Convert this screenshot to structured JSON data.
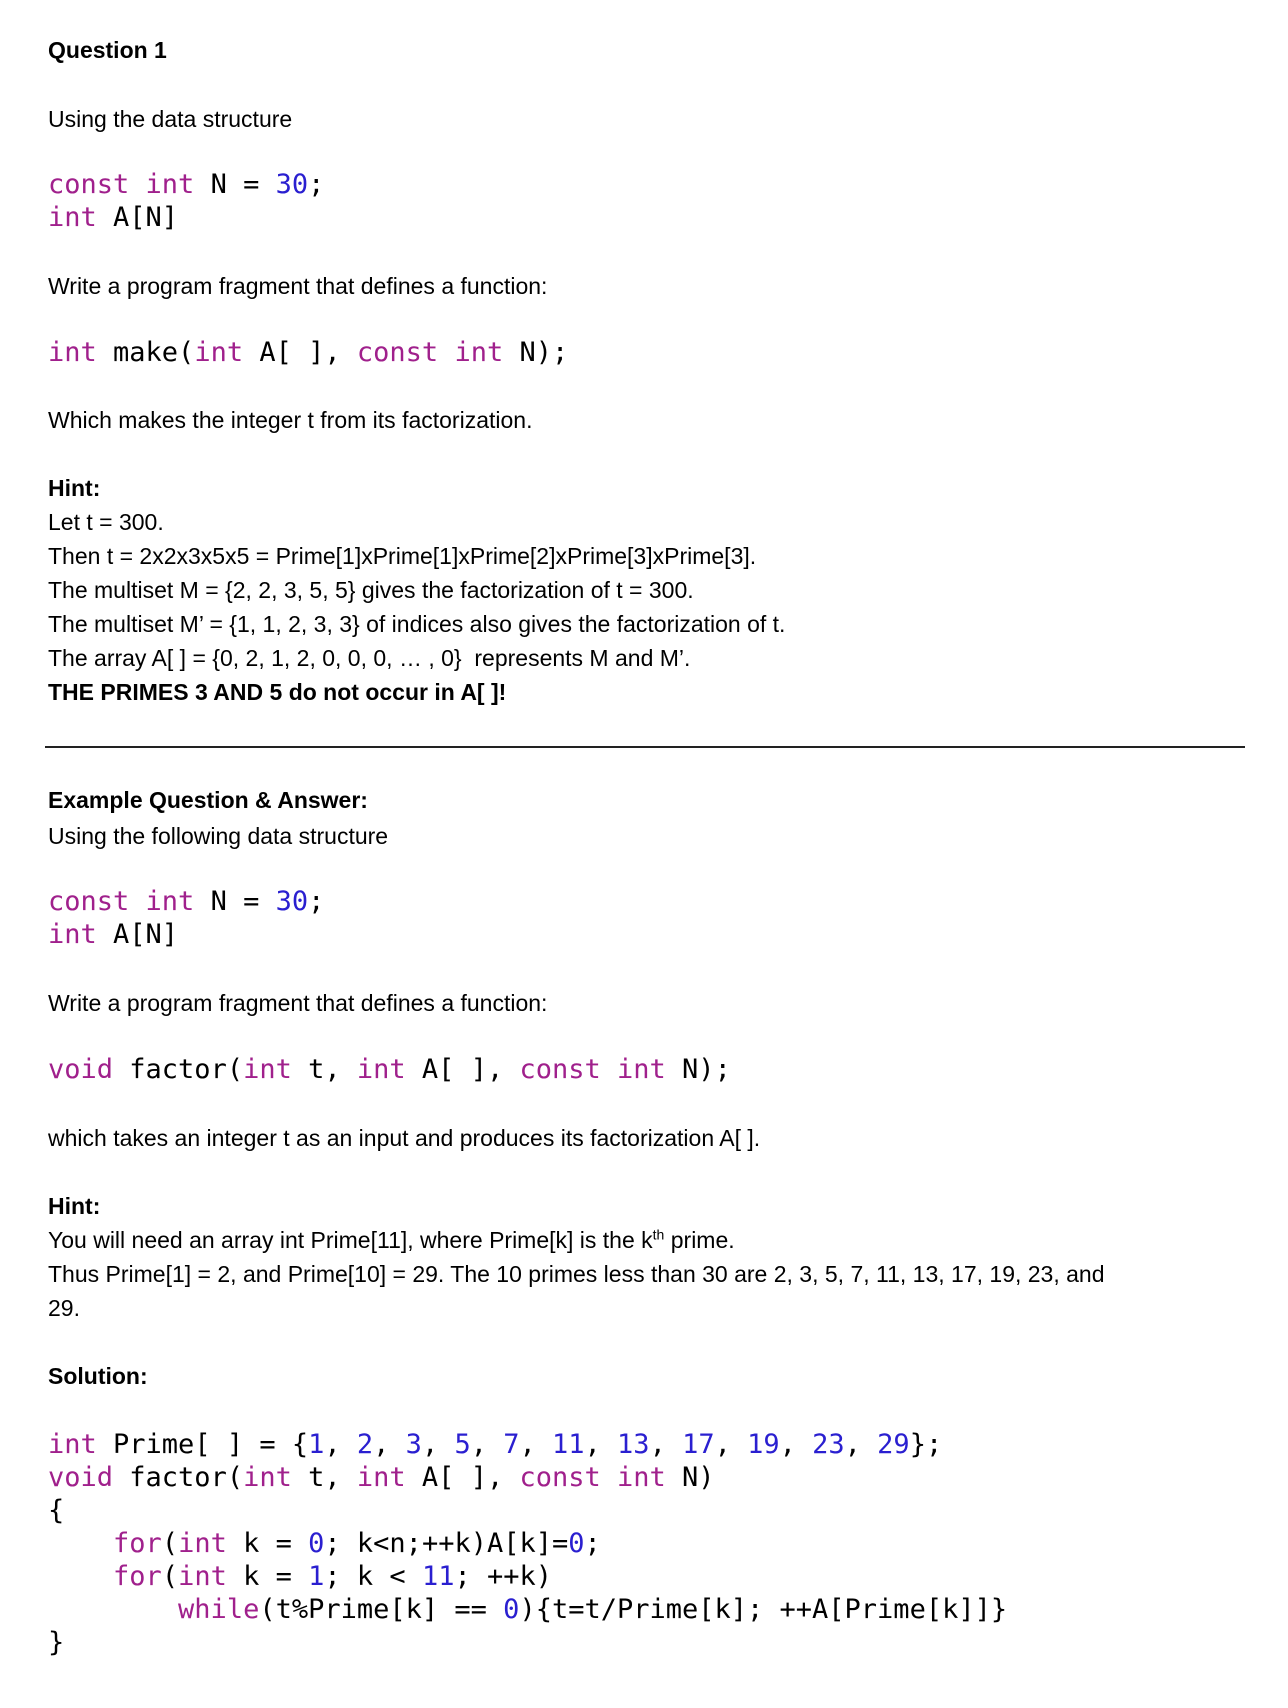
{
  "q1": {
    "title": "Question 1",
    "intro": "Using the data structure",
    "ds_line1": [
      "const",
      " ",
      "int",
      " N = ",
      "30",
      ";"
    ],
    "ds_line2": [
      "int",
      " A[N]"
    ],
    "task": "Write a program fragment that defines a function:",
    "signature": [
      "int",
      " make(",
      "int",
      " A[ ], ",
      "const",
      " ",
      "int",
      " N);"
    ],
    "desc": "Which makes the integer t from its factorization.",
    "hint_title": "Hint:",
    "hint_lines": [
      "Let t = 300.",
      "Then t = 2x2x3x5x5 = Prime[1]xPrime[1]xPrime[2]xPrime[3]xPrime[3].",
      "The multiset M = {2, 2, 3, 5, 5} gives the factorization of t = 300.",
      "The multiset M’ = {1, 1, 2, 3, 3} of indices also gives the factorization of t.",
      "The array A[ ] = {0, 2, 1, 2, 0, 0, 0, … , 0}  represents M and M’."
    ],
    "hint_warning": "THE PRIMES 3 AND 5 do not occur in A[ ]!"
  },
  "example": {
    "title": "Example Question & Answer:",
    "intro": "Using the following data structure",
    "ds_line1": [
      "const",
      " ",
      "int",
      " N = ",
      "30",
      ";"
    ],
    "ds_line2": [
      "int",
      " A[N]"
    ],
    "task": "Write a program fragment that defines a function:",
    "signature": [
      "void",
      " factor(",
      "int",
      " t, ",
      "int",
      " A[ ], ",
      "const",
      " ",
      "int",
      " N);"
    ],
    "desc": "which takes an integer t as an input and produces its factorization A[ ].",
    "hint_title": "Hint:",
    "hint_line1_a": "You will need an array int Prime[11], where Prime[k] is the k",
    "hint_line1_sup": "th",
    "hint_line1_b": " prime.",
    "hint_line2": "Thus Prime[1] = 2, and Prime[10] = 29. The 10 primes less than 30 are 2, 3, 5, 7, 11, 13, 17, 19, 23, and",
    "hint_line3": "29.",
    "solution_title": "Solution:",
    "solution_code": {
      "line1": [
        "int",
        " Prime[ ] = {",
        "1",
        ", ",
        "2",
        ", ",
        "3",
        ", ",
        "5",
        ", ",
        "7",
        ", ",
        "11",
        ", ",
        "13",
        ", ",
        "17",
        ", ",
        "19",
        ", ",
        "23",
        ", ",
        "29",
        "};"
      ],
      "line2": [
        "void",
        " factor(",
        "int",
        " t, ",
        "int",
        " A[ ], ",
        "const",
        " ",
        "int",
        " N)"
      ],
      "line3": "{",
      "line4": [
        "    ",
        "for",
        "(",
        "int",
        " k = ",
        "0",
        "; k<n;++k)A[k]=",
        "0",
        ";"
      ],
      "line5": [
        "    ",
        "for",
        "(",
        "int",
        " k = ",
        "1",
        "; k < ",
        "11",
        "; ++k)"
      ],
      "line6": [
        "        ",
        "while",
        "(t%Prime[k] == ",
        "0",
        "){t=t/Prime[k]; ++A[Prime[k]]}"
      ],
      "line7": "}"
    }
  },
  "colors": {
    "keyword": "#a0208c",
    "number": "#2a1fd0",
    "text": "#000000"
  }
}
